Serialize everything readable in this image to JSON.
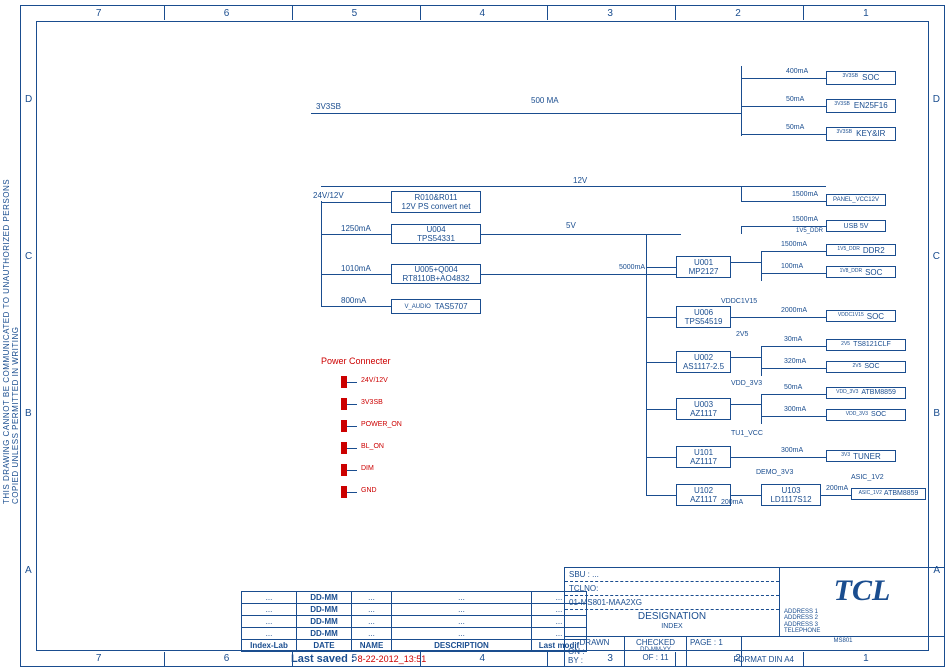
{
  "side_text": "THIS DRAWING CANNOT BE COMMUNICATED TO UNAUTHORIZED PERSONS COPIED UNLESS  PERMITTED IN WRITING",
  "zones_top": [
    "7",
    "6",
    "5",
    "4",
    "3",
    "2",
    "1"
  ],
  "zones_side": [
    "D",
    "C",
    "B",
    "A"
  ],
  "rail_3v3sb": "3V3SB",
  "rail_500ma": "500 MA",
  "rail_12v": "12V",
  "rail_5v": "5V",
  "rail_24v12v": "24V/12V",
  "branches_3v3sb": [
    {
      "cur": "400mA",
      "tag": "3V3SB",
      "dev": "SOC"
    },
    {
      "cur": "50mA",
      "tag": "3V3SB",
      "dev": "EN25F16"
    },
    {
      "cur": "50mA",
      "tag": "3V3SB",
      "dev": "KEY&IR"
    }
  ],
  "blk_r010": {
    "l1": "R010&R011",
    "l2": "12V PS convert net"
  },
  "blk_u004": {
    "l1": "U004",
    "l2": "TPS54331"
  },
  "blk_u005": {
    "l1": "U005+Q004",
    "l2": "RT8110B+AO4832"
  },
  "blk_tas": {
    "tag": "V_AUDIO",
    "dev": "TAS5707"
  },
  "cur_1250": "1250mA",
  "cur_1010": "1010mA",
  "cur_800": "800mA",
  "cur_5000": "5000mA",
  "cur_1500_top": "1500mA",
  "panel_vcc": "PANEL_VCC12V",
  "usb5v": {
    "tag": "1V5_DDR",
    "dev": "USB 5V",
    "cur": "1500mA"
  },
  "u001": {
    "l1": "U001",
    "l2": "MP2127"
  },
  "u001_out": [
    {
      "cur": "1500mA",
      "tag": "1V5_DDR",
      "dev": "DDR2"
    },
    {
      "cur": "100mA",
      "tag": "1V8_DDR",
      "dev": "SOC"
    }
  ],
  "vddc1v15": "VDDC1V15",
  "u006": {
    "l1": "U006",
    "l2": "TPS54519"
  },
  "u006_out": {
    "cur": "2000mA",
    "tag": "VDDC1V15",
    "dev": "SOC"
  },
  "rail_2v5": "2V5",
  "u002": {
    "l1": "U002",
    "l2": "AS1117-2.5"
  },
  "u002_out": [
    {
      "cur": "30mA",
      "tag": "2V5",
      "dev": "TS8121CLF"
    },
    {
      "cur": "320mA",
      "tag": "2V5",
      "dev": "SOC"
    }
  ],
  "vdd_3v3": "VDD_3V3",
  "u003": {
    "l1": "U003",
    "l2": "AZ1117"
  },
  "u003_out": [
    {
      "cur": "50mA",
      "tag": "VDD_3V3",
      "dev": "ATBM8859"
    },
    {
      "cur": "300mA",
      "tag": "VDD_3V3",
      "dev": "SOC"
    }
  ],
  "tu1_vcc": "TU1_VCC",
  "u101": {
    "l1": "U101",
    "l2": "AZ1117"
  },
  "u101_out": {
    "cur": "300mA",
    "tag": "3V3",
    "dev": "TUNER"
  },
  "demo_3v3": "DEMO_3V3",
  "asic_1v2": "ASIC_1V2",
  "u102": {
    "l1": "U102",
    "l2": "AZ1117"
  },
  "u102_cur": "200mA",
  "u103": {
    "l1": "U103",
    "l2": "LD1117S12"
  },
  "u103_out": {
    "cur": "200mA",
    "tag": "ASIC_1V2",
    "dev": "ATBM8859"
  },
  "conn_title": "Power Connecter",
  "conn_pins": [
    "24V/12V",
    "3V3SB",
    "POWER_ON",
    "BL_ON",
    "DIM",
    "GND"
  ],
  "rev_headers": [
    "Index-Lab",
    "DATE",
    "NAME",
    "DESCRIPTION",
    "Last modif"
  ],
  "rev_rows": [
    [
      "...",
      "DD-MM",
      "...",
      "...",
      "..."
    ],
    [
      "...",
      "DD-MM",
      "...",
      "...",
      "..."
    ],
    [
      "...",
      "DD-MM",
      "...",
      "...",
      "..."
    ],
    [
      "...",
      "DD-MM",
      "...",
      "...",
      "..."
    ]
  ],
  "tb_sbu": "SBU :    ...",
  "tb_tclno": "TCLNO:",
  "tb_part": "01-MS801-MAA2XG",
  "tb_designation": "DESIGNATION",
  "tb_index": "INDEX",
  "tb_addr": [
    "ADDRESS 1",
    "ADDRESS 2",
    "ADDRESS 3",
    "TELEPHONE"
  ],
  "tb_drawn": "DRAWN",
  "tb_on": "ON :",
  "tb_by": "BY :",
  "tb_checked": "CHECKED",
  "tb_ddmmyy": "DD-MM-YY",
  "tb_of": "OF :",
  "tb_page": "PAGE :",
  "tb_page_n": "1",
  "tb_of_n": "11",
  "tb_format": "FORMAT DIN  A4",
  "tb_ms": "MS801",
  "tcl": "TCL",
  "last_saved_lbl": "Last saved :",
  "last_saved_val": "8-22-2012_13:51"
}
